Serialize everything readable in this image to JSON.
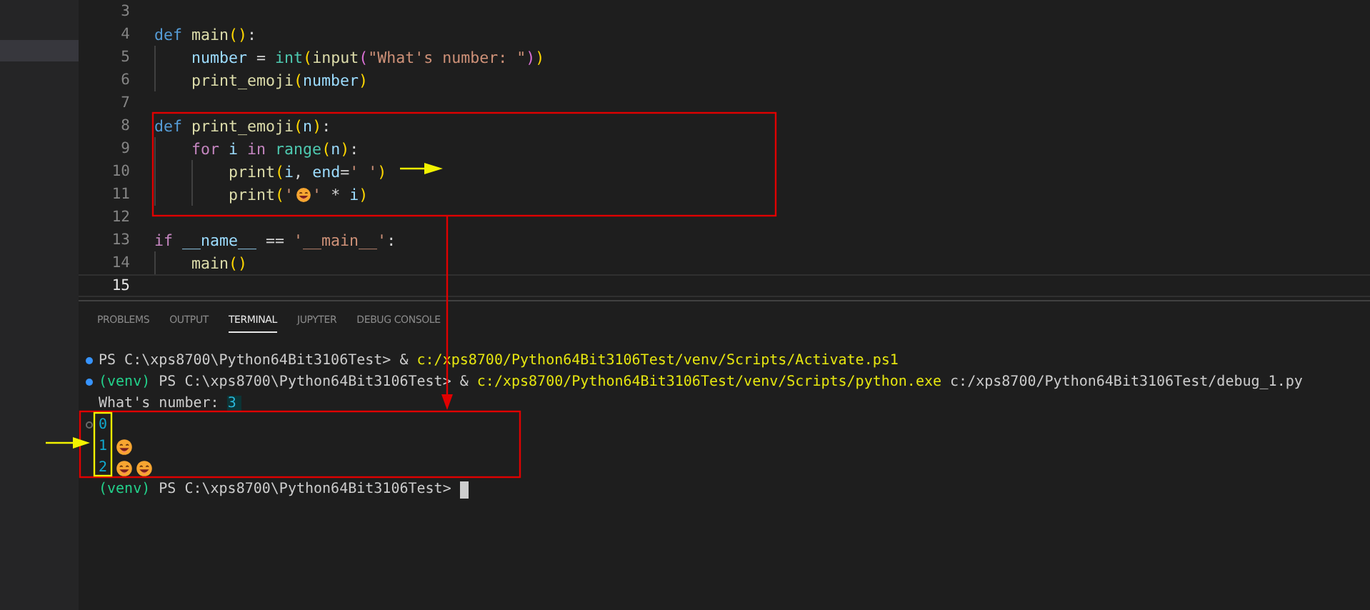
{
  "editor": {
    "lines": [
      {
        "number": "3",
        "selected": false
      },
      {
        "number": "4",
        "selected": false,
        "tokens": [
          {
            "kind": "keyword",
            "text": "def"
          },
          {
            "kind": "function",
            "text": " main"
          },
          {
            "kind": "bracket1",
            "text": "()"
          },
          {
            "kind": "plain",
            "text": ":"
          }
        ],
        "children": [
          {
            "number": "5",
            "selected": false,
            "tokens": [
              {
                "kind": "variable",
                "text": "number"
              },
              {
                "kind": "plain",
                "text": " = "
              },
              {
                "kind": "builtin",
                "text": "int"
              },
              {
                "kind": "bracket1",
                "text": "("
              },
              {
                "kind": "function",
                "text": "input"
              },
              {
                "kind": "bracket2",
                "text": "("
              },
              {
                "kind": "string",
                "text": "\"What's number: \""
              },
              {
                "kind": "bracket2",
                "text": ")"
              },
              {
                "kind": "bracket1",
                "text": ")"
              }
            ]
          },
          {
            "number": "6",
            "selected": false,
            "tokens": [
              {
                "kind": "function",
                "text": "print_emoji"
              },
              {
                "kind": "bracket1",
                "text": "("
              },
              {
                "kind": "variable",
                "text": "number"
              },
              {
                "kind": "bracket1",
                "text": ")"
              }
            ]
          }
        ]
      },
      {
        "number": "7",
        "selected": false
      },
      {
        "number": "8",
        "selected": false,
        "tokens": [
          {
            "kind": "keyword",
            "text": "def"
          },
          {
            "kind": "function",
            "text": " print_emoji"
          },
          {
            "kind": "bracket1",
            "text": "("
          },
          {
            "kind": "variable",
            "text": "n"
          },
          {
            "kind": "bracket1",
            "text": ")"
          },
          {
            "kind": "plain",
            "text": ":"
          }
        ],
        "children": [
          {
            "number": "9",
            "selected": false,
            "tokens": [
              {
                "kind": "control",
                "text": "for"
              },
              {
                "kind": "variable",
                "text": " i"
              },
              {
                "kind": "control",
                "text": " in"
              },
              {
                "kind": "builtin",
                "text": " range"
              },
              {
                "kind": "bracket1",
                "text": "("
              },
              {
                "kind": "variable",
                "text": "n"
              },
              {
                "kind": "bracket1",
                "text": ")"
              },
              {
                "kind": "plain",
                "text": ":"
              }
            ],
            "children": [
              {
                "number": "10",
                "selected": false,
                "tokens": [
                  {
                    "kind": "function",
                    "text": "print"
                  },
                  {
                    "kind": "bracket1",
                    "text": "("
                  },
                  {
                    "kind": "variable",
                    "text": "i"
                  },
                  {
                    "kind": "plain",
                    "text": ", "
                  },
                  {
                    "kind": "variable",
                    "text": "end"
                  },
                  {
                    "kind": "plain",
                    "text": "="
                  },
                  {
                    "kind": "string",
                    "text": "' '"
                  },
                  {
                    "kind": "bracket1",
                    "text": ")"
                  }
                ]
              },
              {
                "number": "11",
                "selected": false,
                "tokens": [
                  {
                    "kind": "function",
                    "text": "print"
                  },
                  {
                    "kind": "bracket1",
                    "text": "("
                  },
                  {
                    "kind": "string",
                    "text": "'"
                  },
                  {
                    "kind": "emoji"
                  },
                  {
                    "kind": "string",
                    "text": "'"
                  },
                  {
                    "kind": "plain",
                    "text": " * "
                  },
                  {
                    "kind": "variable",
                    "text": "i"
                  },
                  {
                    "kind": "bracket1",
                    "text": ")"
                  }
                ]
              }
            ]
          }
        ]
      },
      {
        "number": "12",
        "selected": false
      },
      {
        "number": "13",
        "selected": false,
        "tokens": [
          {
            "kind": "control",
            "text": "if"
          },
          {
            "kind": "variable",
            "text": " __name__"
          },
          {
            "kind": "plain",
            "text": " == "
          },
          {
            "kind": "string",
            "text": "'__main__'"
          },
          {
            "kind": "plain",
            "text": ":"
          }
        ],
        "children": [
          {
            "number": "14",
            "selected": false,
            "tokens": [
              {
                "kind": "function",
                "text": "main"
              },
              {
                "kind": "bracket1",
                "text": "()"
              }
            ]
          }
        ]
      },
      {
        "number": "15",
        "selected": true
      }
    ]
  },
  "panel": {
    "tabs": [
      {
        "label": "PROBLEMS",
        "selected": false
      },
      {
        "label": "OUTPUT",
        "selected": false
      },
      {
        "label": "TERMINAL",
        "selected": true
      },
      {
        "label": "JUPYTER",
        "selected": false
      },
      {
        "label": "DEBUG CONSOLE",
        "selected": false
      }
    ],
    "terminal": [
      {
        "kind": "success",
        "segments": [
          {
            "kind": "plain",
            "text": "PS C:\\xps8700\\Python64Bit3106Test> & "
          },
          {
            "kind": "path",
            "text": "c:/xps8700/Python64Bit3106Test/venv/Scripts/Activate.ps1"
          }
        ]
      },
      {
        "kind": "success",
        "segments": [
          {
            "kind": "env",
            "text": "(venv)"
          },
          {
            "kind": "plain",
            "text": " PS C:\\xps8700\\Python64Bit3106Test> & "
          },
          {
            "kind": "path",
            "text": "c:/xps8700/Python64Bit3106Test/venv/Scripts/python.exe"
          },
          {
            "kind": "plain",
            "text": " c:/xps8700/Python64Bit3106Test/debug_1.py"
          }
        ]
      },
      {
        "kind": "plain",
        "segments": [
          {
            "kind": "plain",
            "text": "What's number: "
          },
          {
            "kind": "input",
            "text": "3"
          }
        ]
      },
      {
        "kind": "running",
        "segments": [
          {
            "kind": "number",
            "text": "0"
          }
        ]
      },
      {
        "kind": "plain",
        "segments": [
          {
            "kind": "number",
            "text": "1"
          },
          {
            "kind": "emoji"
          }
        ]
      },
      {
        "kind": "plain",
        "segments": [
          {
            "kind": "number",
            "text": "2"
          },
          {
            "kind": "emoji"
          },
          {
            "kind": "emoji"
          }
        ]
      },
      {
        "kind": "plain",
        "segments": [
          {
            "kind": "env",
            "text": "(venv)"
          },
          {
            "kind": "plain",
            "text": " PS C:\\xps8700\\Python64Bit3106Test> "
          },
          {
            "kind": "cursor"
          }
        ]
      }
    ]
  }
}
